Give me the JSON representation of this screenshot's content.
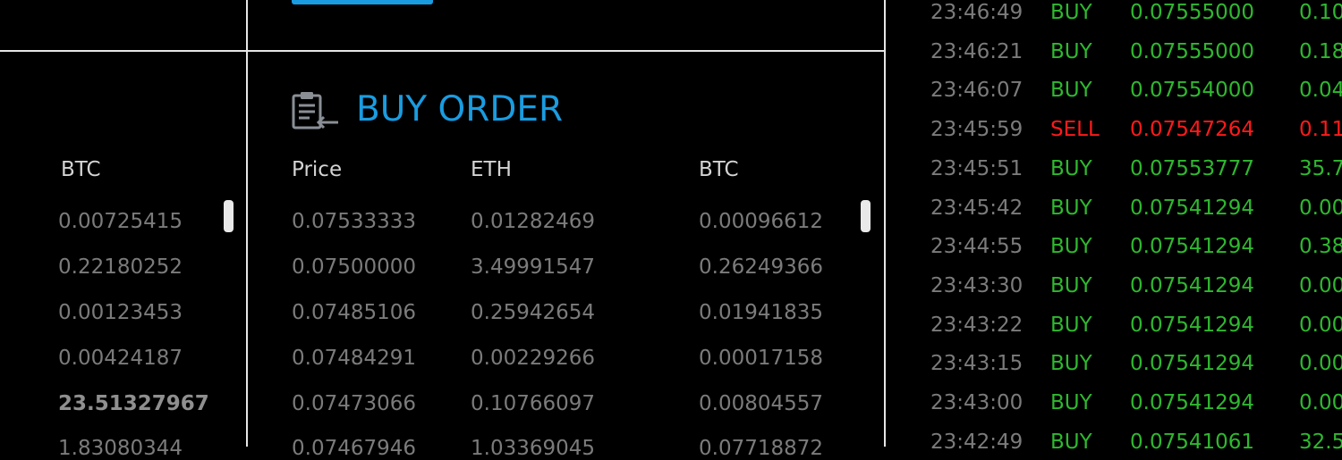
{
  "top_button": {
    "label": ""
  },
  "left_panel": {
    "header": "BTC",
    "rows": [
      "0.00725415",
      "0.22180252",
      "0.00123453",
      "0.00424187",
      "23.51327967",
      "1.83080344"
    ]
  },
  "buy_order": {
    "title": "BUY ORDER",
    "icon": "clipboard-list-icon",
    "columns": {
      "price": "Price",
      "eth": "ETH",
      "btc": "BTC"
    },
    "rows": [
      {
        "price": "0.07533333",
        "eth": "0.01282469",
        "btc": "0.00096612"
      },
      {
        "price": "0.07500000",
        "eth": "3.49991547",
        "btc": "0.26249366"
      },
      {
        "price": "0.07485106",
        "eth": "0.25942654",
        "btc": "0.01941835"
      },
      {
        "price": "0.07484291",
        "eth": "0.00229266",
        "btc": "0.00017158"
      },
      {
        "price": "0.07473066",
        "eth": "0.10766097",
        "btc": "0.00804557"
      },
      {
        "price": "0.07467946",
        "eth": "1.03369045",
        "btc": "0.07718872"
      }
    ]
  },
  "trades": [
    {
      "time": "23:46:49",
      "side": "BUY",
      "price": "0.07555000",
      "amount": "0.10"
    },
    {
      "time": "23:46:21",
      "side": "BUY",
      "price": "0.07555000",
      "amount": "0.18"
    },
    {
      "time": "23:46:07",
      "side": "BUY",
      "price": "0.07554000",
      "amount": "0.04"
    },
    {
      "time": "23:45:59",
      "side": "SELL",
      "price": "0.07547264",
      "amount": "0.11"
    },
    {
      "time": "23:45:51",
      "side": "BUY",
      "price": "0.07553777",
      "amount": "35.7"
    },
    {
      "time": "23:45:42",
      "side": "BUY",
      "price": "0.07541294",
      "amount": "0.00"
    },
    {
      "time": "23:44:55",
      "side": "BUY",
      "price": "0.07541294",
      "amount": "0.38"
    },
    {
      "time": "23:43:30",
      "side": "BUY",
      "price": "0.07541294",
      "amount": "0.00"
    },
    {
      "time": "23:43:22",
      "side": "BUY",
      "price": "0.07541294",
      "amount": "0.00"
    },
    {
      "time": "23:43:15",
      "side": "BUY",
      "price": "0.07541294",
      "amount": "0.00"
    },
    {
      "time": "23:43:00",
      "side": "BUY",
      "price": "0.07541294",
      "amount": "0.00"
    },
    {
      "time": "23:42:49",
      "side": "BUY",
      "price": "0.07541061",
      "amount": "32.5"
    }
  ],
  "colors": {
    "accent": "#1a9ce0",
    "buy": "#2fb82f",
    "sell": "#ff1a1a",
    "muted_text": "#7b7b7b",
    "divider": "#e6e6e6"
  }
}
